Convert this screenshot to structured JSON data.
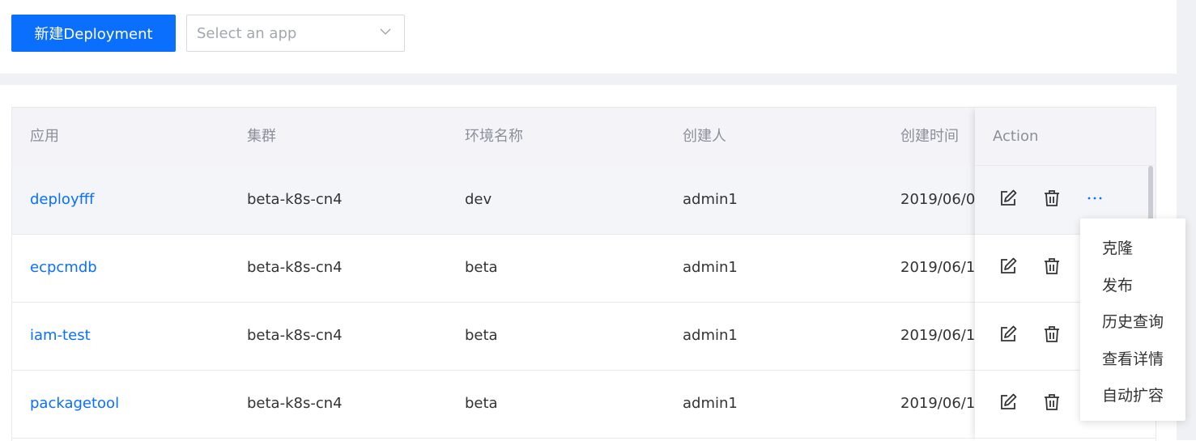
{
  "toolbar": {
    "create_button_label": "新建Deployment",
    "app_select_placeholder": "Select an app"
  },
  "table": {
    "columns": {
      "app": "应用",
      "cluster": "集群",
      "env": "环境名称",
      "creator": "创建人",
      "created_time": "创建时间",
      "action": "Action"
    },
    "rows": [
      {
        "app": "deployfff",
        "cluster": "beta-k8s-cn4",
        "env": "dev",
        "creator": "admin1",
        "created_time": "2019/06/0"
      },
      {
        "app": "ecpcmdb",
        "cluster": "beta-k8s-cn4",
        "env": "beta",
        "creator": "admin1",
        "created_time": "2019/06/1"
      },
      {
        "app": "iam-test",
        "cluster": "beta-k8s-cn4",
        "env": "beta",
        "creator": "admin1",
        "created_time": "2019/06/1"
      },
      {
        "app": "packagetool",
        "cluster": "beta-k8s-cn4",
        "env": "beta",
        "creator": "admin1",
        "created_time": "2019/06/1"
      }
    ]
  },
  "more_menu": {
    "items": [
      "克隆",
      "发布",
      "历史查询",
      "查看详情",
      "自动扩容"
    ]
  },
  "icons": {
    "edit": "edit-icon",
    "delete": "trash-icon",
    "more": "more-icon",
    "chevron": "chevron-down-icon"
  },
  "colors": {
    "accent": "#0b6ffd",
    "header_bg": "#f4f4f8",
    "text": "#333333",
    "muted": "#8a8f99"
  }
}
